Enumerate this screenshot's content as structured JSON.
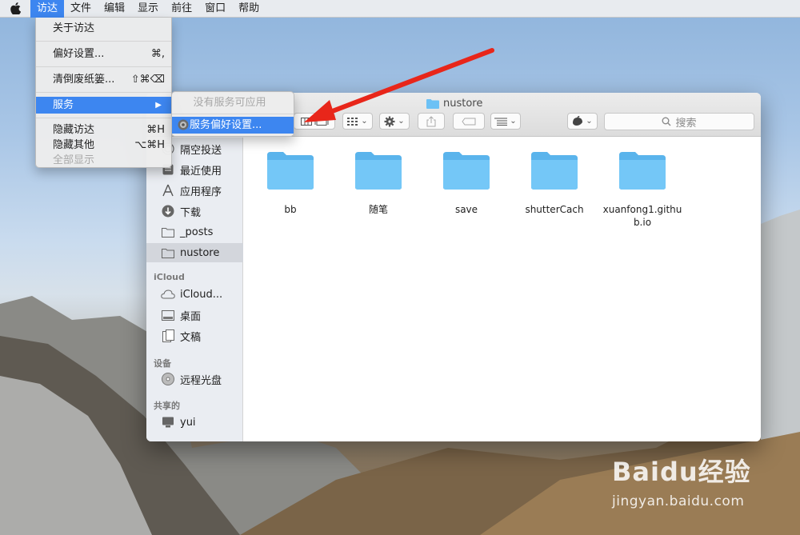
{
  "menubar": {
    "items": [
      "访达",
      "文件",
      "编辑",
      "显示",
      "前往",
      "窗口",
      "帮助"
    ]
  },
  "finder_menu": {
    "about": "关于访达",
    "prefs": "偏好设置...",
    "prefs_shortcut": "⌘,",
    "empty_trash": "清倒废纸篓...",
    "empty_trash_shortcut": "⇧⌘⌫",
    "services": "服务",
    "hide": "隐藏访达",
    "hide_shortcut": "⌘H",
    "hide_others": "隐藏其他",
    "hide_others_shortcut": "⌥⌘H",
    "show_all": "全部显示"
  },
  "services_submenu": {
    "none": "没有服务可应用",
    "prefs": "服务偏好设置..."
  },
  "window": {
    "title": "nustore",
    "search_placeholder": "搜索"
  },
  "sidebar": {
    "items": [
      {
        "label": "隔空投送",
        "icon": "airdrop-icon"
      },
      {
        "label": "最近使用",
        "icon": "recents-icon"
      },
      {
        "label": "应用程序",
        "icon": "applications-icon"
      },
      {
        "label": "下载",
        "icon": "downloads-icon"
      },
      {
        "label": "_posts",
        "icon": "folder-icon"
      },
      {
        "label": "nustore",
        "icon": "folder-icon"
      }
    ],
    "icloud_header": "iCloud",
    "icloud_items": [
      {
        "label": "iCloud...",
        "icon": "cloud-icon"
      },
      {
        "label": "桌面",
        "icon": "desktop-icon"
      },
      {
        "label": "文稿",
        "icon": "documents-icon"
      }
    ],
    "devices_header": "设备",
    "device_items": [
      {
        "label": "远程光盘",
        "icon": "disc-icon"
      }
    ],
    "shared_header": "共享的",
    "shared_items": [
      {
        "label": "yui",
        "icon": "computer-icon"
      }
    ]
  },
  "files": [
    "bb",
    "随笔",
    "save",
    "shutterCach",
    "xuanfong1.github.io"
  ],
  "watermark": {
    "brand": "Baidu经验",
    "url": "jingyan.baidu.com"
  },
  "colors": {
    "selection": "#3d86f0",
    "folder": "#6cc1f5",
    "arrow": "#e8261a"
  }
}
